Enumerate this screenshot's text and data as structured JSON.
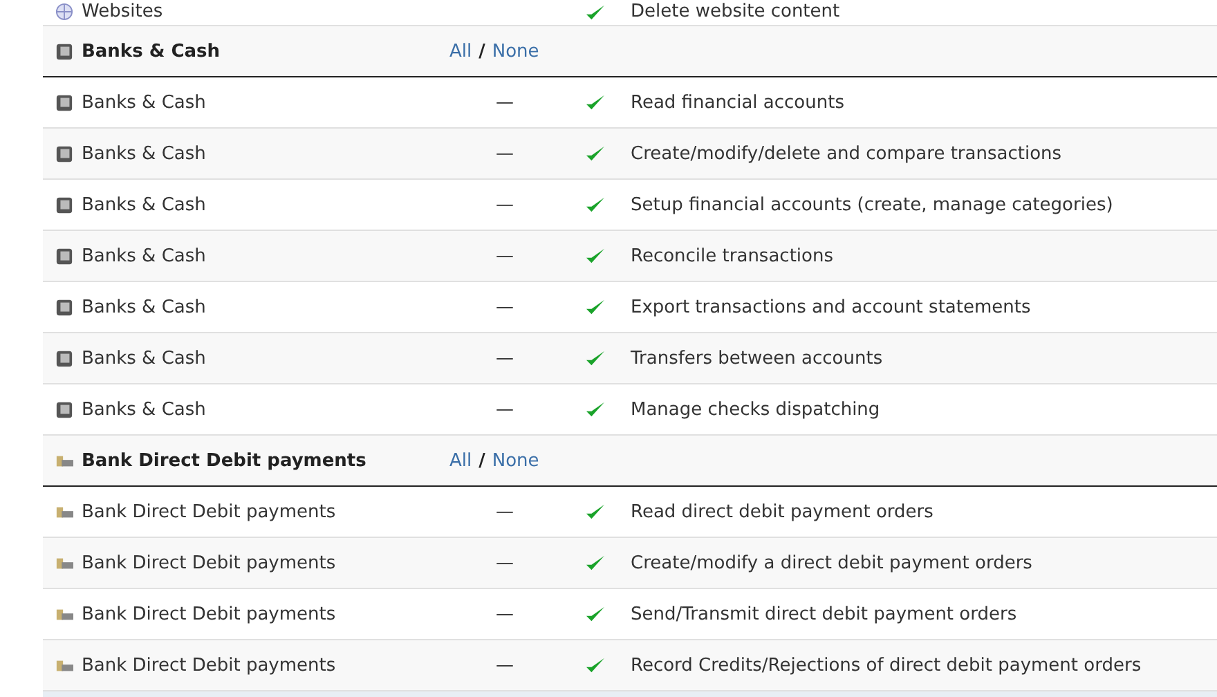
{
  "top_row": {
    "module": "Websites",
    "granted": true,
    "permission": "Delete website content"
  },
  "sections": [
    {
      "kind": "safe",
      "title": "Banks & Cash",
      "all_link": "All",
      "separator": "/",
      "none_link": "None",
      "rows": [
        {
          "module": "Banks & Cash",
          "status": "—",
          "granted": true,
          "permission": "Read financial accounts"
        },
        {
          "module": "Banks & Cash",
          "status": "—",
          "granted": true,
          "permission": "Create/modify/delete and compare transactions"
        },
        {
          "module": "Banks & Cash",
          "status": "—",
          "granted": true,
          "permission": "Setup financial accounts (create, manage categories)"
        },
        {
          "module": "Banks & Cash",
          "status": "—",
          "granted": true,
          "permission": "Reconcile transactions"
        },
        {
          "module": "Banks & Cash",
          "status": "—",
          "granted": true,
          "permission": "Export transactions and account statements"
        },
        {
          "module": "Banks & Cash",
          "status": "—",
          "granted": true,
          "permission": "Transfers between accounts"
        },
        {
          "module": "Banks & Cash",
          "status": "—",
          "granted": true,
          "permission": "Manage checks dispatching"
        }
      ]
    },
    {
      "kind": "debit",
      "title": "Bank Direct Debit payments",
      "all_link": "All",
      "separator": "/",
      "none_link": "None",
      "rows": [
        {
          "module": "Bank Direct Debit payments",
          "status": "—",
          "granted": true,
          "permission": "Read direct debit payment orders"
        },
        {
          "module": "Bank Direct Debit payments",
          "status": "—",
          "granted": true,
          "permission": "Create/modify a direct debit payment orders"
        },
        {
          "module": "Bank Direct Debit payments",
          "status": "—",
          "granted": true,
          "permission": "Send/Transmit direct debit payment orders"
        },
        {
          "module": "Bank Direct Debit payments",
          "status": "—",
          "granted": true,
          "permission": "Record Credits/Rejections of direct debit payment orders"
        }
      ]
    }
  ]
}
